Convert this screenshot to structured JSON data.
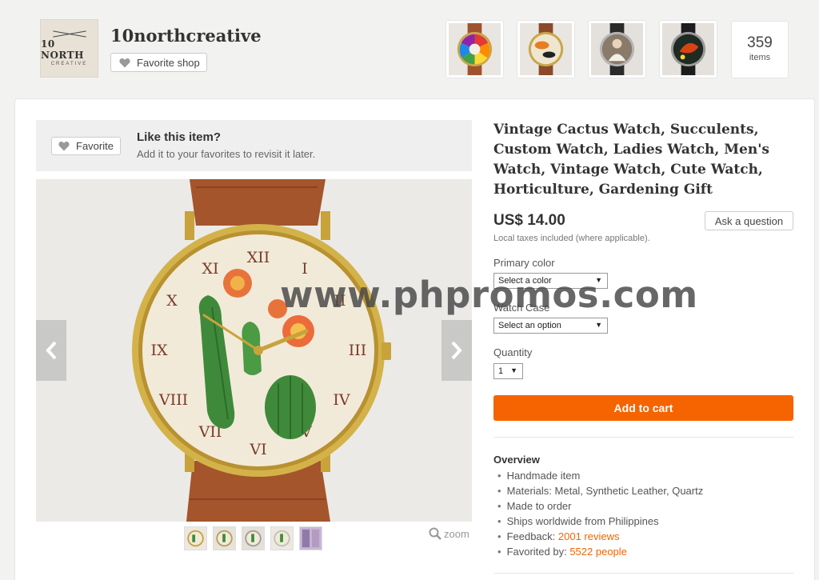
{
  "shop": {
    "name": "10northcreative",
    "favorite_label": "Favorite shop",
    "logo_text_main": "10 NORTH",
    "logo_text_sub": "CREATIVE",
    "items_count": "359",
    "items_label": "items"
  },
  "favorite_banner": {
    "button_label": "Favorite",
    "title": "Like this item?",
    "subtitle": "Add it to your favorites to revisit it later."
  },
  "gallery": {
    "prev_icon": "chevron-left-icon",
    "next_icon": "chevron-right-icon",
    "zoom_label": "zoom"
  },
  "listing": {
    "title": "Vintage Cactus Watch, Succulents, Custom Watch, Ladies Watch, Men's Watch, Vintage Watch, Cute Watch, Horticulture, Gardening Gift",
    "price": "US$ 14.00",
    "tax_note": "Local taxes included (where applicable).",
    "ask_question_label": "Ask a question",
    "primary_color_label": "Primary color",
    "primary_color_value": "Select a color",
    "watch_case_label": "Watch Case",
    "watch_case_value": "Select an option",
    "quantity_label": "Quantity",
    "quantity_value": "1",
    "add_to_cart_label": "Add to cart"
  },
  "overview": {
    "title": "Overview",
    "items": [
      {
        "text": "Handmade item"
      },
      {
        "text": "Materials: Metal, Synthetic Leather, Quartz"
      },
      {
        "text": "Made to order"
      },
      {
        "text": "Ships worldwide from Philippines"
      },
      {
        "text": "Feedback: ",
        "link": "2001 reviews"
      },
      {
        "text": "Favorited by: ",
        "link": "5522 people"
      }
    ]
  },
  "watermark": "www.phpromos.com",
  "colors": {
    "accent": "#f56400",
    "background": "#f2f2f1",
    "card": "#ffffff"
  }
}
